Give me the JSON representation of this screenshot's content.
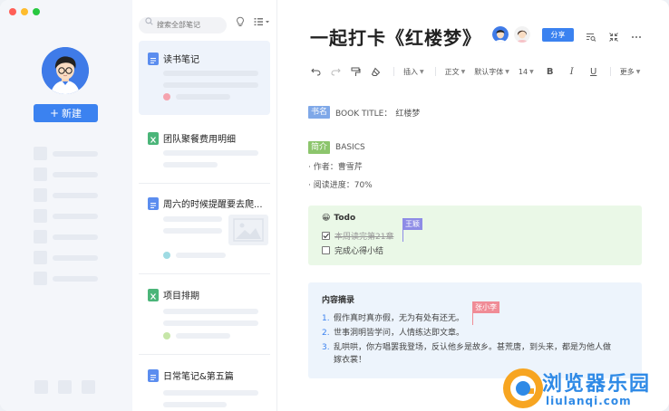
{
  "window": {
    "controls": [
      "close",
      "minimize",
      "zoom"
    ],
    "control_colors": [
      "#ff5f57",
      "#febc2e",
      "#28c840"
    ]
  },
  "sidebar": {
    "new_button": {
      "icon": "plus-icon",
      "label": "新建"
    },
    "accent": "#3b82f0"
  },
  "note_list": {
    "search_placeholder": "搜索全部笔记",
    "notes": [
      {
        "title": "读书笔记",
        "type": "doc",
        "active": true,
        "dot_color": "#f5a3ae"
      },
      {
        "title": "团队聚餐费用明细",
        "type": "sheet",
        "active": false
      },
      {
        "title": "周六的时候提醒要去爬...",
        "type": "doc",
        "active": false,
        "dot_color": "#9fdbe3"
      },
      {
        "title": "项目排期",
        "type": "sheet",
        "active": false,
        "dot_color": "#c6e6a8"
      },
      {
        "title": "日常笔记&第五篇",
        "type": "doc",
        "active": false
      }
    ]
  },
  "editor": {
    "title": "一起打卡《红楼梦》",
    "share_label": "分享",
    "toolbar": {
      "insert": "插入",
      "paragraph": "正文",
      "font": "默认字体",
      "size": "14",
      "bold": "B",
      "italic": "I",
      "underline": "U",
      "more": "更多"
    },
    "book": {
      "tag": "书名",
      "label": "BOOK TITLE：",
      "value": "红楼梦",
      "tag_color": "#7fa8e8"
    },
    "basics": {
      "tag": "简介",
      "label": "BASICS",
      "tag_color": "#8cc56c",
      "author": "· 作者：曹雪芹",
      "progress": "· 阅读进度：70%"
    },
    "todo": {
      "emoji": "😀",
      "heading": "Todo",
      "items": [
        {
          "text": "本周读完第21章",
          "checked": true
        },
        {
          "text": "完成心得小结",
          "checked": false
        }
      ],
      "cursor_user": "王颖",
      "cursor_color": "#8e8ce6"
    },
    "excerpt": {
      "heading": "内容摘录",
      "items": [
        {
          "num": "1.",
          "text": "假作真时真亦假，无为有处有还无。"
        },
        {
          "num": "2.",
          "text": "世事洞明皆学问，人情练达即文章。"
        },
        {
          "num": "3.",
          "text": "乱哄哄，你方唱罢我登场，反认他乡是故乡。甚荒唐，到头来，都是为他人做"
        }
      ],
      "wrap_line": "嫁衣裳！",
      "cursor_user": "张小李",
      "cursor_color": "#f08c96"
    }
  },
  "watermark": {
    "text": "浏览器乐园",
    "sub": "liulanqi.com"
  }
}
